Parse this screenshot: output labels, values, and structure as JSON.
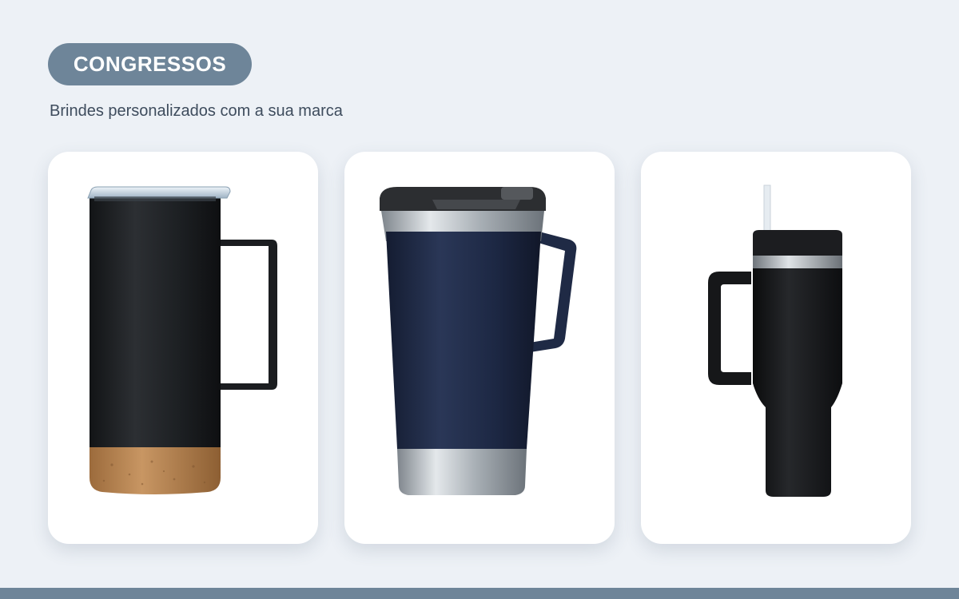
{
  "header": {
    "badge_label": "CONGRESSOS",
    "subtitle": "Brindes personalizados com a sua marca"
  },
  "products": [
    {
      "icon": "travel-mug-cork-base-icon",
      "body_color": "#1e2124",
      "accent_color": "#b98554"
    },
    {
      "icon": "beer-tumbler-lid-icon",
      "body_color": "#1f2a45",
      "accent_color": "#c4c9cf"
    },
    {
      "icon": "tumbler-straw-handle-icon",
      "body_color": "#17181a",
      "accent_color": "#aeb3b8"
    }
  ],
  "colors": {
    "background": "#edf1f6",
    "accent": "#6e8599",
    "card": "#ffffff",
    "subtitle_text": "#3e4c5d"
  }
}
